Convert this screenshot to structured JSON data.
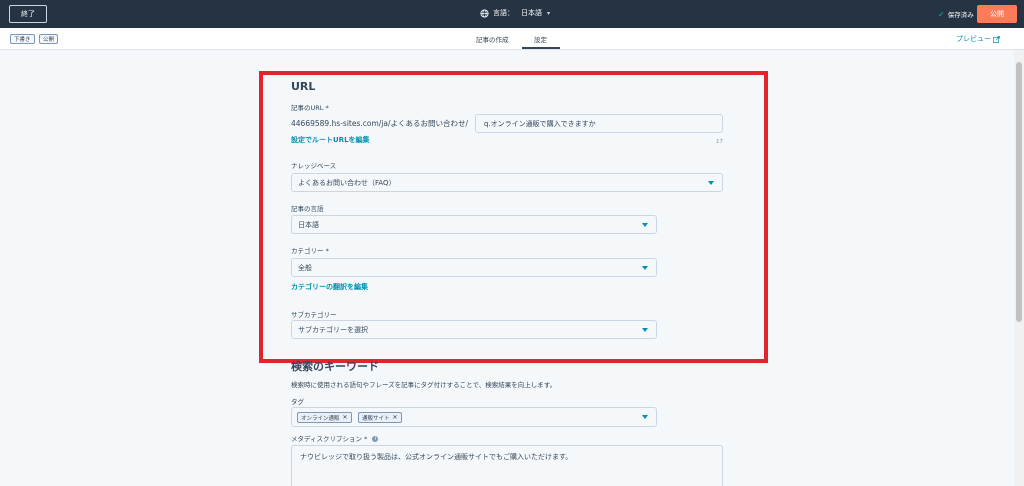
{
  "topbar": {
    "exit_label": "終了",
    "language_label": "言語：",
    "language_value": "日本語",
    "saved_label": "保存済み",
    "publish_label": "公開"
  },
  "subbar": {
    "status_draft": "下書き",
    "status_published": "公開",
    "tab_compose": "記事の作成",
    "tab_settings": "設定",
    "preview_label": "プレビュー"
  },
  "url_section": {
    "heading": "URL",
    "article_url_label": "記事のURL",
    "required_mark": "*",
    "url_prefix": "44669589.hs-sites.com/ja/よくあるお問い合わせ/",
    "slug_value": "q.オンライン通販で購入できますか",
    "slug_count": "17",
    "edit_root_url_link": "設定でルートURLを編集"
  },
  "knowledge_base": {
    "label": "ナレッジベース",
    "value": "よくあるお問い合わせ（FAQ）"
  },
  "article_language": {
    "label": "記事の言語",
    "value": "日本語"
  },
  "category": {
    "label": "カテゴリー",
    "required_mark": "*",
    "value": "全般",
    "edit_translation_link": "カテゴリーの翻訳を編集"
  },
  "subcategory": {
    "label": "サブカテゴリー",
    "placeholder": "サブカテゴリーを選択"
  },
  "keywords_section": {
    "heading": "検索のキーワード",
    "description": "検索時に使用される語句やフレーズを記事にタグ付けすることで、検索結果を向上します。",
    "tags_label": "タグ",
    "tags": [
      "オンライン通販",
      "通販サイト"
    ]
  },
  "meta_description": {
    "label": "メタディスクリプション",
    "required_mark": "*",
    "value": "ナウビレッジで取り扱う製品は、公式オンライン通販サイトでもご購入いただけます。"
  },
  "colors": {
    "accent": "#0091ae",
    "publish_button": "#ff7a59",
    "topbar": "#253342",
    "highlight_border": "#e0262b"
  }
}
